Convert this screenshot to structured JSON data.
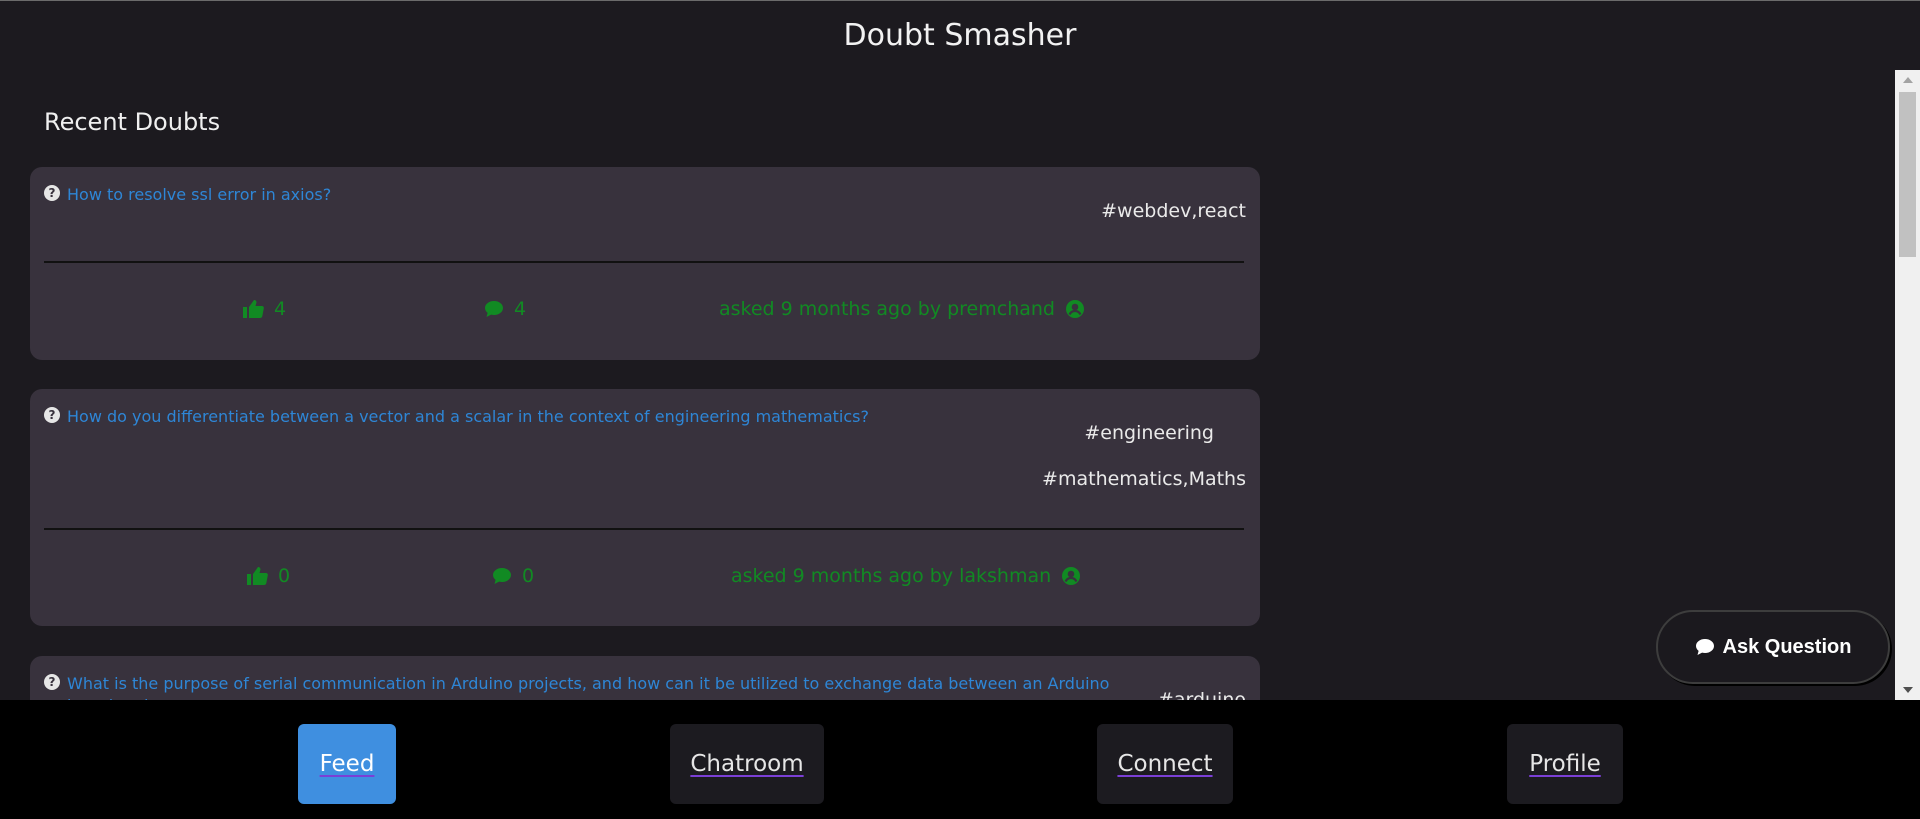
{
  "app": {
    "title": "Doubt Smasher"
  },
  "feed": {
    "section_title": "Recent Doubts",
    "doubts": [
      {
        "question": "How to resolve ssl error in axios?",
        "tags": [
          "#webdev,react"
        ],
        "likes": "4",
        "comments": "4",
        "meta": "asked 9 months ago by premchand"
      },
      {
        "question": "How do you differentiate between a vector and a scalar in the context of engineering mathematics?",
        "tags": [
          "#engineering",
          "#mathematics,Maths"
        ],
        "likes": "0",
        "comments": "0",
        "meta": "asked 9 months ago by lakshman"
      },
      {
        "question": "What is the purpose of serial communication in Arduino projects, and how can it be utilized to exchange data between an Arduino board and a",
        "tags": [
          "#arduino"
        ]
      }
    ]
  },
  "ask_button": {
    "label": "Ask Question"
  },
  "nav": {
    "items": [
      {
        "label": "Feed",
        "active": true
      },
      {
        "label": "Chatroom"
      },
      {
        "label": "Connect"
      },
      {
        "label": "Profile"
      }
    ]
  },
  "colors": {
    "background": "#1c1a1f",
    "card": "#38323d",
    "question_link": "#2e86d6",
    "stat_green": "#118a23",
    "nav_active": "#3f8fe0"
  },
  "icons": [
    "question-circle-icon",
    "thumbs-up-icon",
    "comment-icon",
    "user-circle-icon"
  ]
}
